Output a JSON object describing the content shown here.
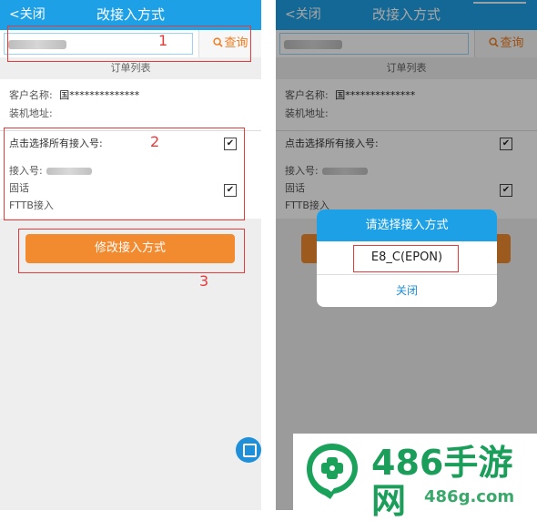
{
  "screen_left": {
    "header": {
      "back_label": "<关闭",
      "title": "改接入方式"
    },
    "search": {
      "button_label": "查询"
    },
    "order_list_title": "订单列表",
    "customer": {
      "name_label": "客户名称:",
      "name_value": "国**************",
      "address_label": "装机地址:"
    },
    "select_all_label": "点击选择所有接入号:",
    "access": {
      "number_label": "接入号:",
      "type_line": "固话",
      "method_line": "FTTB接入"
    },
    "modify_button_label": "修改接入方式",
    "annotations": [
      "1",
      "2",
      "3"
    ]
  },
  "screen_right": {
    "header": {
      "back_label": "<关闭",
      "title": "改接入方式"
    },
    "search": {
      "button_label": "查询"
    },
    "order_list_title": "订单列表",
    "customer": {
      "name_label": "客户名称:",
      "name_value": "国**************",
      "address_label": "装机地址:"
    },
    "select_all_label": "点击选择所有接入号:",
    "access": {
      "number_label": "接入号:",
      "type_line": "固话",
      "method_line": "FTTB接入"
    },
    "dialog": {
      "title": "请选择接入方式",
      "option": "E8_C(EPON)",
      "close_label": "关闭"
    }
  },
  "watermark": {
    "main": "486手游网",
    "sub": "486g.com"
  },
  "colors": {
    "header_blue": "#1ea0e6",
    "action_orange": "#f28a30",
    "annotation_red": "#e53b3b",
    "watermark_green": "#1a9e59"
  }
}
